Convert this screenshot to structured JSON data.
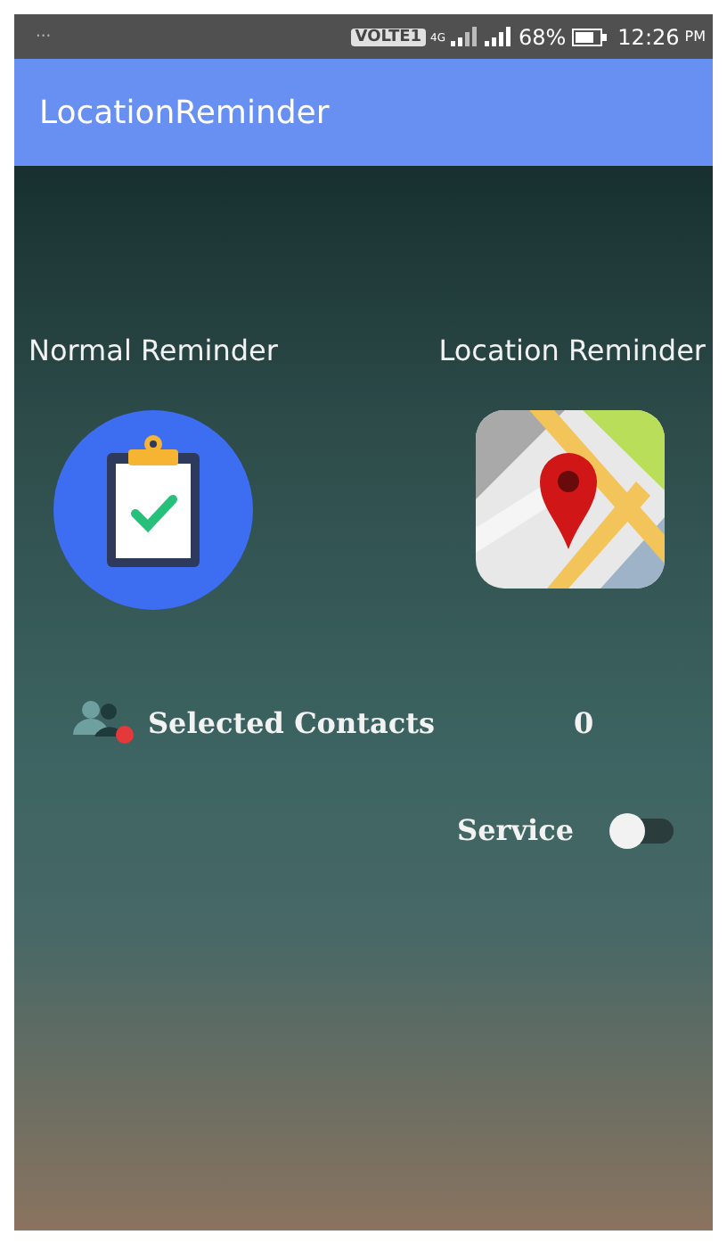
{
  "status_bar": {
    "notification": "···",
    "network_badge": "VOLTE1",
    "network_type": "4G",
    "battery": "68%",
    "time": "12:26",
    "time_suffix": "PM"
  },
  "app_bar": {
    "title": "LocationReminder"
  },
  "reminder_options": [
    {
      "kind": "normal",
      "label": "Normal Reminder"
    },
    {
      "kind": "location",
      "label": "Location Reminder"
    }
  ],
  "contacts": {
    "label": "Selected Contacts",
    "count": "0"
  },
  "service": {
    "label": "Service",
    "on": false
  }
}
